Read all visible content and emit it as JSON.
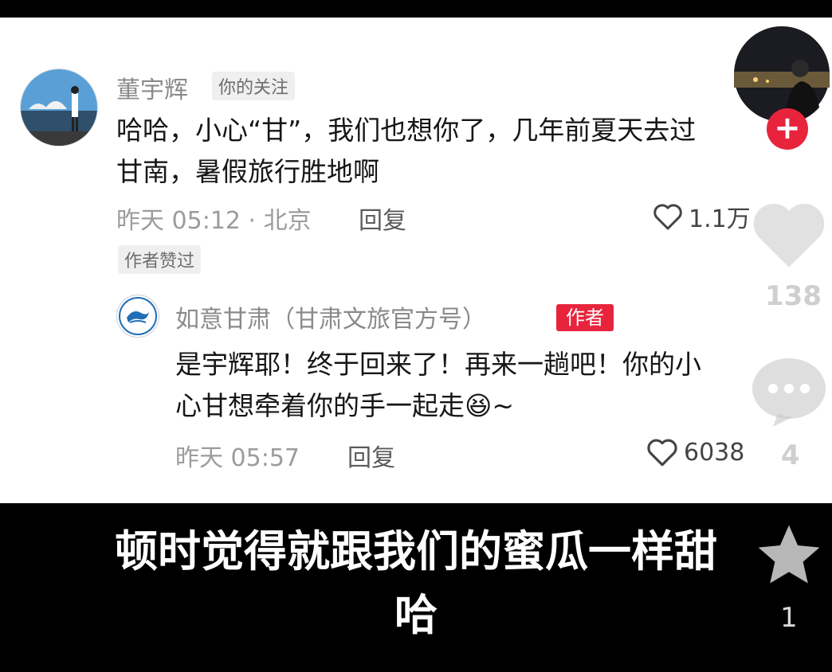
{
  "creator": {
    "follow_symbol": "+"
  },
  "comment": {
    "username": "董宇辉",
    "follow_tag": "你的关注",
    "text_line1": "哈哈，小心“甘”，我们也想你了，几年前夏天去过",
    "text_line2": "甘南，暑假旅行胜地啊",
    "timestamp": "昨天 05:12 · 北京",
    "reply_label": "回复",
    "like_count": "1.1万",
    "author_liked_tag": "作者赞过"
  },
  "reply": {
    "username": "如意甘肃（甘肃文旅官方号）",
    "author_badge": "作者",
    "text_line1": "是宇辉耶！终于回来了！再来一趟吧！你的小",
    "text_line2": "心甘想牵着你的手一起走",
    "text_suffix": "~",
    "emoji": "😆",
    "timestamp": "昨天 05:57",
    "reply_label": "回复",
    "like_count": "6038"
  },
  "sidebar": {
    "like_count": "138",
    "comment_count": "4",
    "favorite_count": "1"
  },
  "caption": {
    "line1": "顿时觉得就跟我们的蜜瓜一样甜",
    "line2": "哈"
  },
  "colors": {
    "accent_red": "#e8243d",
    "caption_text": "#ffffff",
    "background": "#000000"
  }
}
